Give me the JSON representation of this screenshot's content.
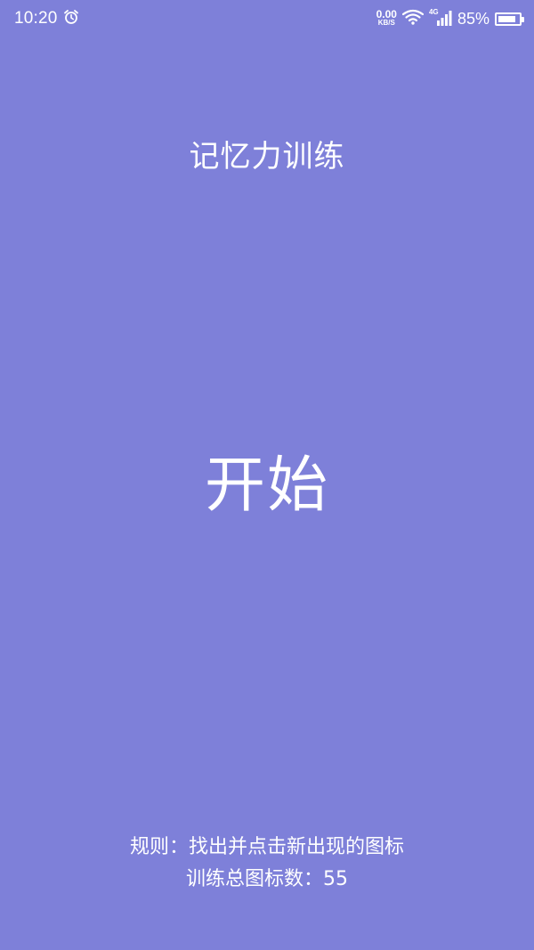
{
  "status_bar": {
    "time": "10:20",
    "net_speed_value": "0.00",
    "net_speed_unit": "KB/S",
    "network_gen": "4G",
    "battery_percent_text": "85%",
    "battery_level": 0.85,
    "icons": [
      "alarm-icon",
      "wifi-icon",
      "cellular-signal-icon",
      "battery-icon"
    ]
  },
  "title": "记忆力训练",
  "start_button": {
    "label": "开始"
  },
  "footer": {
    "rules_label": "规则：",
    "rules_text": "找出并点击新出现的图标",
    "count_label": "训练总图标数：",
    "count_value": "55"
  },
  "colors": {
    "background": "#7e80d9",
    "text": "#ffffff"
  }
}
